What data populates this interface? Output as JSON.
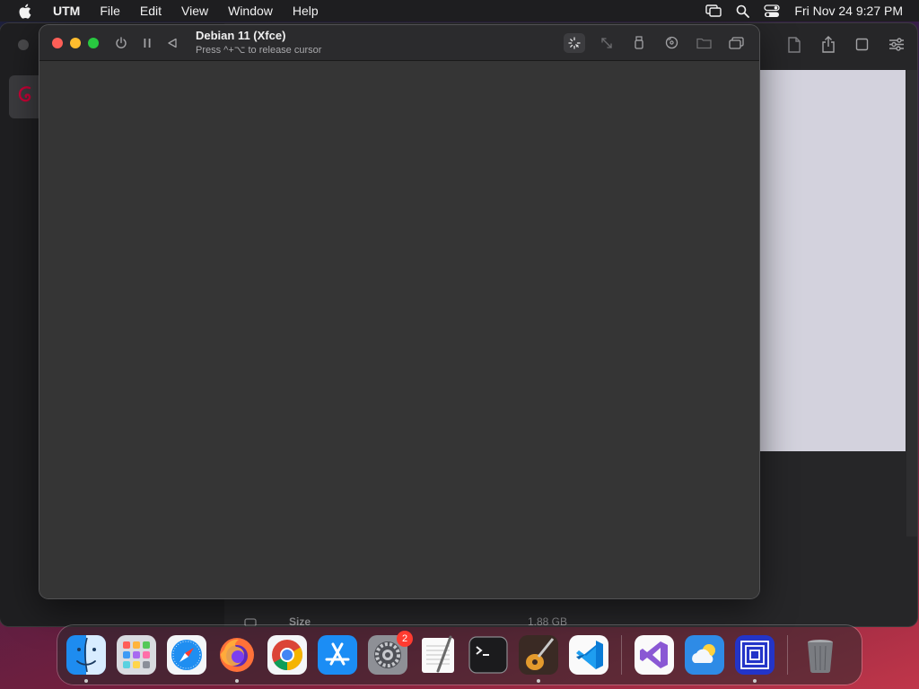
{
  "menubar": {
    "app_name": "UTM",
    "menus": [
      "File",
      "Edit",
      "View",
      "Window",
      "Help"
    ],
    "clock": "Fri Nov 24  9:27 PM"
  },
  "vm_window": {
    "title": "Debian 11 (Xfce)",
    "subtitle": "Press ^+⌥ to release cursor"
  },
  "background_window": {
    "info_label": "Size",
    "info_value": "1.88 GB"
  },
  "dock": {
    "items": [
      {
        "name": "finder",
        "running": true
      },
      {
        "name": "launchpad",
        "running": false
      },
      {
        "name": "safari",
        "running": false
      },
      {
        "name": "firefox",
        "running": true
      },
      {
        "name": "chrome",
        "running": false
      },
      {
        "name": "app-store",
        "running": false
      },
      {
        "name": "system-settings",
        "running": false,
        "badge": "2"
      },
      {
        "name": "textedit",
        "running": false
      },
      {
        "name": "terminal",
        "running": false
      },
      {
        "name": "garageband",
        "running": true
      },
      {
        "name": "vscode",
        "running": false
      },
      {
        "name": "visual-studio",
        "running": false
      },
      {
        "name": "weather",
        "running": false
      },
      {
        "name": "utm",
        "running": true
      },
      {
        "name": "trash",
        "running": false
      }
    ],
    "badge_system_settings": "2"
  },
  "colors": {
    "close": "#fe5f57",
    "minimize": "#febc2e",
    "zoom": "#28c840",
    "vm_screen": "#353535"
  }
}
